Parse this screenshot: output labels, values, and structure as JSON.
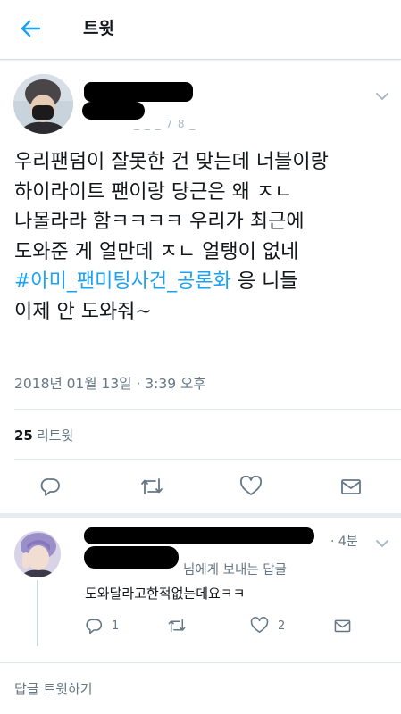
{
  "header": {
    "title": "트윗"
  },
  "tweet": {
    "handle_tail": "_ _ _ 7 8 _",
    "text_lines": [
      "우리팬덤이 잘못한 건 맞는데 너블이랑",
      "하이라이트 팬이랑 당근은 왜 ㅈㄴ",
      "나몰라라 함ㅋㅋㅋㅋ 우리가 최근에",
      "도와준 게 얼만데 ㅈㄴ 얼탱이 없네"
    ],
    "hashtag": "#아미_팬미팅사건_공론화",
    "text_after_hashtag": " 응 니들",
    "text_last_line": "이제 안 도와줘~",
    "timestamp": "2018년 01월 13일 · 3:39 오후",
    "retweet_count": "25",
    "retweet_label": "리트윗"
  },
  "reply": {
    "time": "· 4분",
    "reply_to": "님에게 보내는 답글",
    "text": "도와달라고한적없는데요ㅋㅋ",
    "reply_count": "1",
    "like_count": "2"
  },
  "composer": {
    "placeholder": "답글 트윗하기"
  },
  "colors": {
    "accent": "#1da1f2",
    "secondary_text": "#657786",
    "icon": "#657786"
  }
}
